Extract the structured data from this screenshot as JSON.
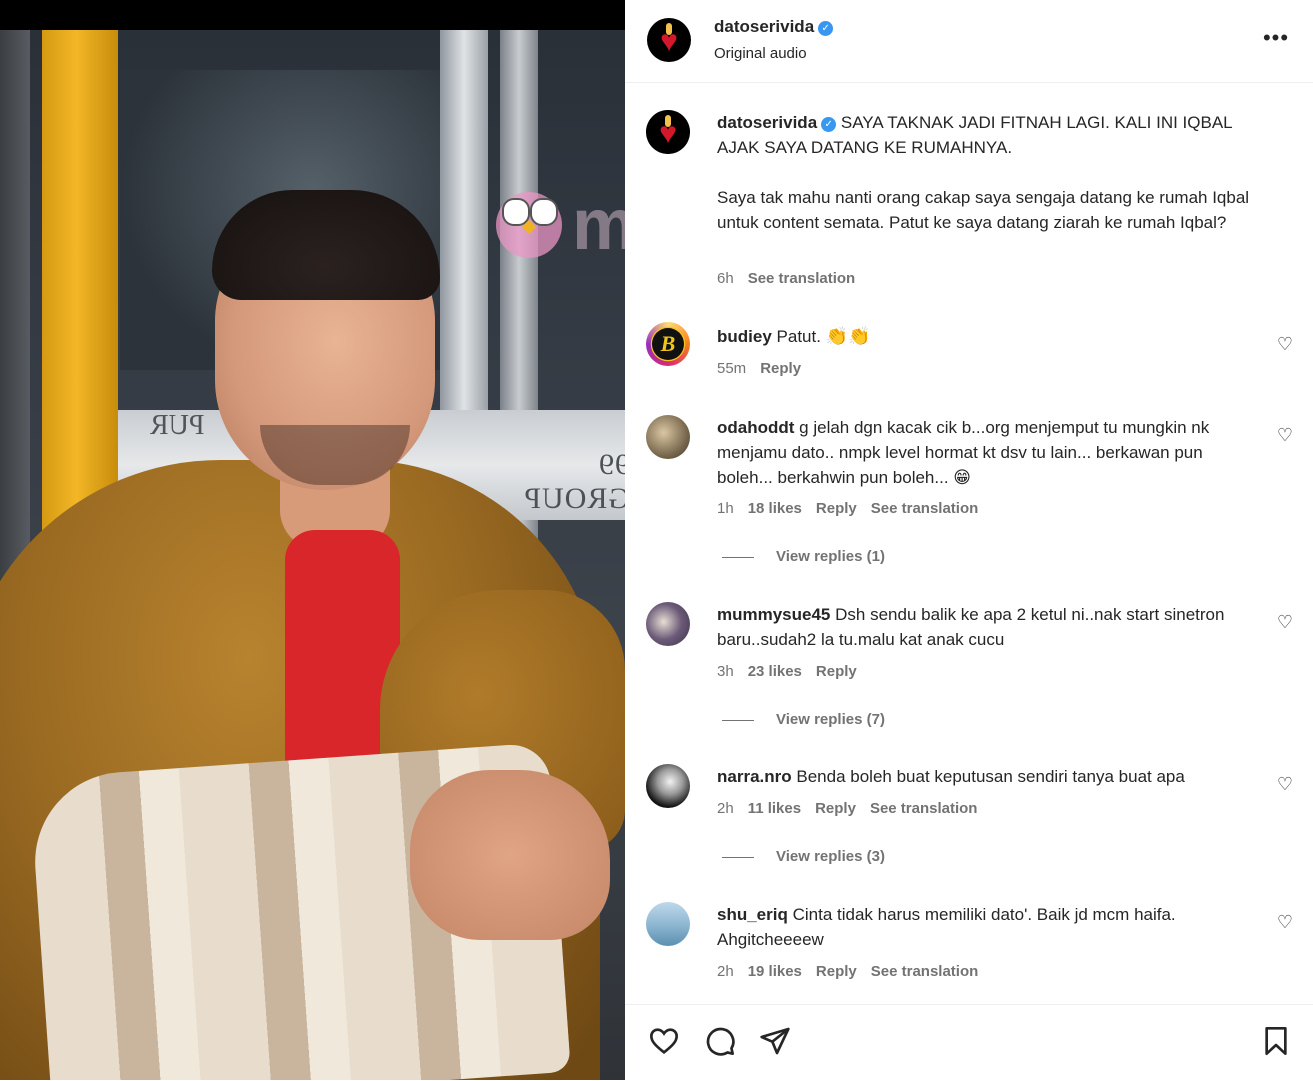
{
  "media": {
    "watermark_text": "murai",
    "sign_text": "99 GROUP",
    "sign_text2": "PUR"
  },
  "header": {
    "username": "datoserivida",
    "audio": "Original audio",
    "more_icon": "more-horizontal-icon"
  },
  "caption": {
    "username": "datoserivida",
    "text_line1": "SAYA TAKNAK JADI FITNAH LAGI. KALI INI IQBAL AJAK SAYA DATANG KE RUMAHNYA.",
    "text_line2": "Saya tak mahu nanti orang cakap saya sengaja datang ke rumah Iqbal untuk content semata. Patut ke saya datang ziarah ke rumah Iqbal?",
    "time": "6h",
    "see_translation": "See translation"
  },
  "comments": [
    {
      "username": "budiey",
      "text": "Patut.",
      "emoji": "👏👏",
      "time": "55m",
      "reply": "Reply"
    },
    {
      "username": "odahoddt",
      "text": "g jelah dgn kacak cik b...org menjemput tu mungkin nk menjamu dato.. nmpk level hormat kt dsv tu lain... berkawan pun boleh... berkahwin pun boleh...",
      "emoji": "😁",
      "time": "1h",
      "likes": "18 likes",
      "reply": "Reply",
      "see_translation": "See translation",
      "view_replies": "View replies (1)"
    },
    {
      "username": "mummysue45",
      "text": "Dsh sendu balik ke apa 2 ketul ni..nak start sinetron baru..sudah2 la tu.malu kat anak cucu",
      "time": "3h",
      "likes": "23 likes",
      "reply": "Reply",
      "view_replies": "View replies (7)"
    },
    {
      "username": "narra.nro",
      "text": "Benda boleh buat keputusan sendiri tanya buat apa",
      "time": "2h",
      "likes": "11 likes",
      "reply": "Reply",
      "see_translation": "See translation",
      "view_replies": "View replies (3)"
    },
    {
      "username": "shu_eriq",
      "text": "Cinta tidak harus memiliki dato'. Baik jd mcm haifa. Ahgitcheeeew",
      "time": "2h",
      "likes": "19 likes",
      "reply": "Reply",
      "see_translation": "See translation"
    }
  ],
  "footer": {
    "icons": [
      "heart-icon",
      "comment-icon",
      "share-icon",
      "bookmark-icon"
    ]
  },
  "colors": {
    "verified": "#3897f0",
    "meta_text": "#737373",
    "primary_text": "#262626"
  }
}
